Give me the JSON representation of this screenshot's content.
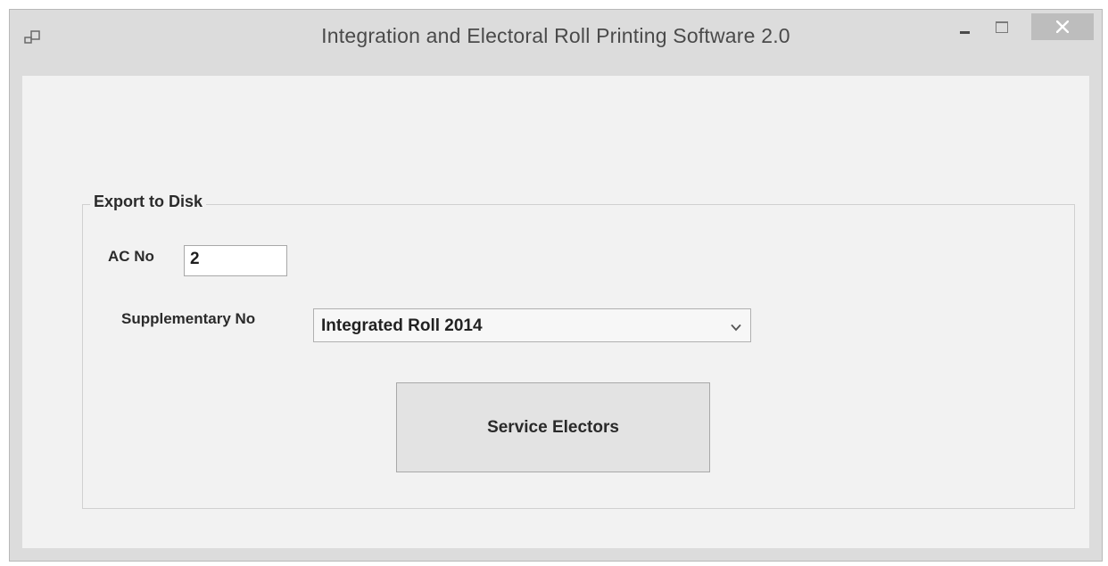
{
  "window": {
    "title": "Integration and Electoral Roll Printing Software 2.0",
    "controls": {
      "minimize_icon": "minimize-icon",
      "maximize_icon": "maximize-icon",
      "close_icon": "close-icon"
    }
  },
  "export_group": {
    "legend": "Export to Disk",
    "ac_no": {
      "label": "AC No",
      "value": "2"
    },
    "supplementary_no": {
      "label": "Supplementary No",
      "selected": "Integrated Roll 2014"
    },
    "service_electors_button": {
      "label": "Service Electors"
    }
  },
  "colors": {
    "title_bar": "#dcdcdc",
    "client_area": "#f2f2f2",
    "close_button": "#bdbdbd"
  }
}
